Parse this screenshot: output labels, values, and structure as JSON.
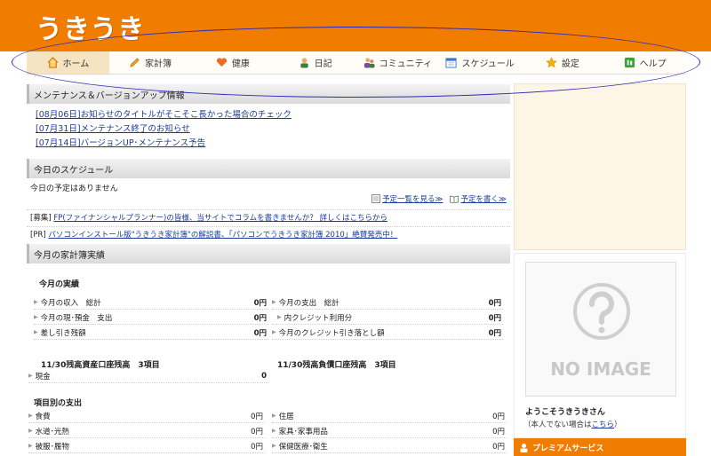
{
  "header": {
    "logo": "うきうき"
  },
  "nav": [
    {
      "label": "ホーム",
      "icon": "home-icon"
    },
    {
      "label": "家計簿",
      "icon": "pencil-icon"
    },
    {
      "label": "健康",
      "icon": "heart-icon"
    },
    {
      "label": "日記",
      "icon": "person-icon"
    },
    {
      "label": "コミュニティ",
      "icon": "people-icon"
    },
    {
      "label": "スケジュール",
      "icon": "calendar-icon"
    },
    {
      "label": "設定",
      "icon": "star-icon"
    },
    {
      "label": "ヘルプ",
      "icon": "help-icon"
    }
  ],
  "maintenance": {
    "title": "メンテナンス＆バージョンアップ情報",
    "items": [
      "[08月06日]お知らせのタイトルがそこそこ長かった場合のチェック",
      "[07月31日]メンテナンス終了のお知らせ",
      "[07月14日]バージョンUP･メンテナンス予告"
    ]
  },
  "schedule": {
    "title": "今日のスケジュール",
    "empty": "今日の予定はありません",
    "link_list": "予定一覧を見る≫",
    "link_write": "予定を書く≫"
  },
  "promos": [
    {
      "tag": "[募集]",
      "text": "FP(ファイナンシャルプランナー)の皆様、当サイトでコラムを書きませんか？ 詳しくはこちらから"
    },
    {
      "tag": "[PR]",
      "text": "パソコンインストール版\"うきうき家計簿\"の解説書、「パソコンでうきうき家計簿 2010」絶賛発売中！"
    }
  ],
  "kakeibo": {
    "title": "今月の家計簿実績",
    "actual_title": "今月の実績",
    "left_rows": [
      {
        "label": "今月の収入　総計",
        "amount": "0円"
      },
      {
        "label": "今月の現･預金　支出",
        "amount": "0円"
      },
      {
        "label": "差し引き残額",
        "amount": "0円"
      }
    ],
    "right_rows": [
      {
        "label": "今月の支出　総計",
        "amount": "0円"
      },
      {
        "label": "内クレジット利用分",
        "amount": "0円"
      },
      {
        "label": "今月のクレジット引き落とし額",
        "amount": "0円"
      }
    ],
    "asset_title": "11/30残高資産口座残高　3項目",
    "debt_title": "11/30残高負債口座残高　3項目",
    "asset_rows": [
      {
        "label": "現金",
        "amount": "0"
      }
    ],
    "by_item_title": "項目別の支出",
    "items_left": [
      {
        "label": "食費",
        "amount": "0円"
      },
      {
        "label": "水道･光熱",
        "amount": "0円"
      },
      {
        "label": "被服･履物",
        "amount": "0円"
      }
    ],
    "items_right": [
      {
        "label": "住居",
        "amount": "0円"
      },
      {
        "label": "家具･家事用品",
        "amount": "0円"
      },
      {
        "label": "保健医療･衛生",
        "amount": "0円"
      }
    ]
  },
  "side": {
    "noimage": "NO IMAGE",
    "welcome": "ようこそうきうきさん",
    "notyou_prefix": "（本人でない場合は",
    "notyou_link": "こちら",
    "notyou_suffix": "）",
    "premium": "プレミアムサービス"
  },
  "colors": {
    "brand": "#f07c00",
    "link": "#1a3a99",
    "annotation": "#2a2ab8"
  }
}
